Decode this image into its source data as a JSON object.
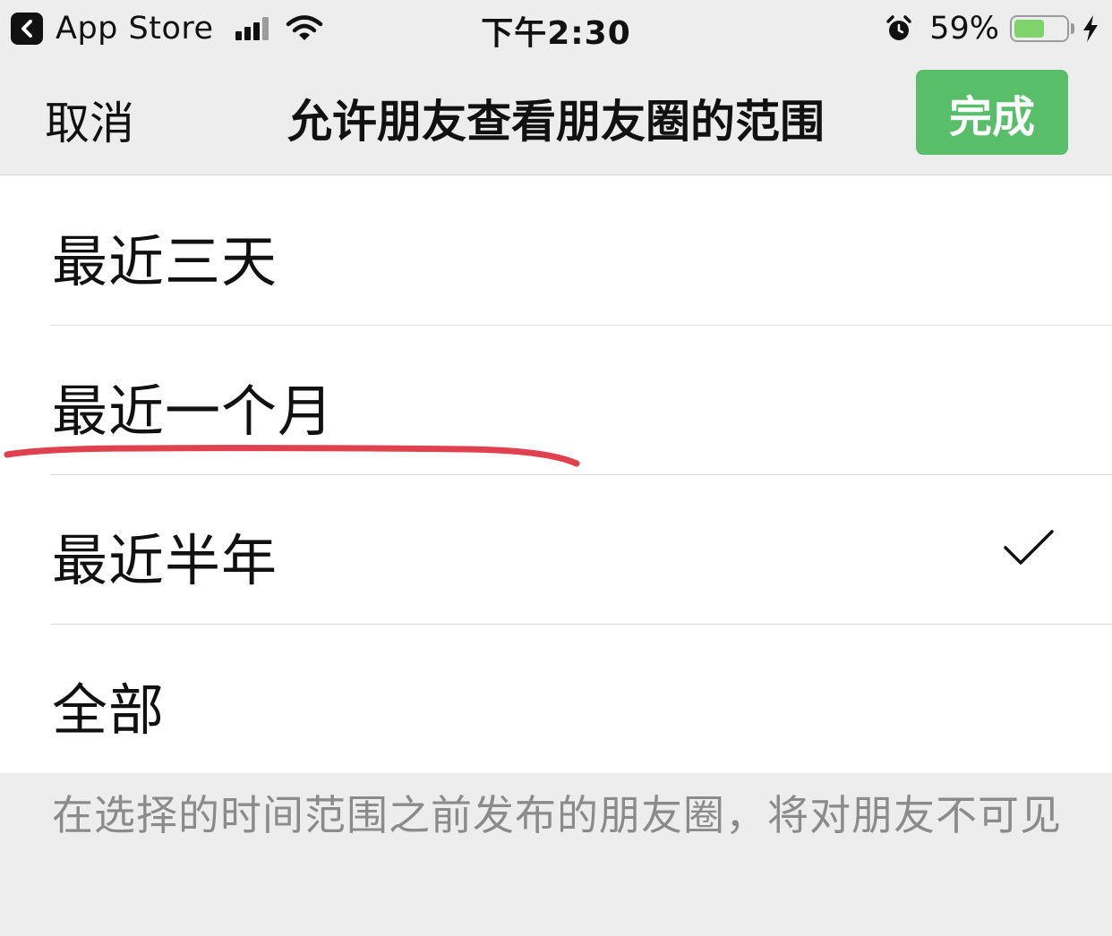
{
  "status_bar": {
    "back_app": "App Store",
    "time": "下午2:30",
    "battery_percent_label": "59%",
    "battery_level": 0.59,
    "signal_bars": 3,
    "signal_bars_total": 4
  },
  "nav": {
    "cancel_label": "取消",
    "title": "允许朋友查看朋友圈的范围",
    "done_label": "完成"
  },
  "options": [
    {
      "label": "最近三天",
      "selected": false
    },
    {
      "label": "最近一个月",
      "selected": false
    },
    {
      "label": "最近半年",
      "selected": true
    },
    {
      "label": "全部",
      "selected": false
    }
  ],
  "footnote": "在选择的时间范围之前发布的朋友圈，将对朋友不可见",
  "colors": {
    "accent_green": "#58be6a",
    "battery_green": "#7ed36b",
    "annotation_red": "#e0414f",
    "background": "#ededed"
  },
  "icons": {
    "back": "chevron-left-icon",
    "signal": "signal-bars-icon",
    "wifi": "wifi-icon",
    "alarm": "alarm-clock-icon",
    "battery": "battery-icon",
    "charging": "lightning-bolt-icon",
    "selected": "checkmark-icon"
  }
}
